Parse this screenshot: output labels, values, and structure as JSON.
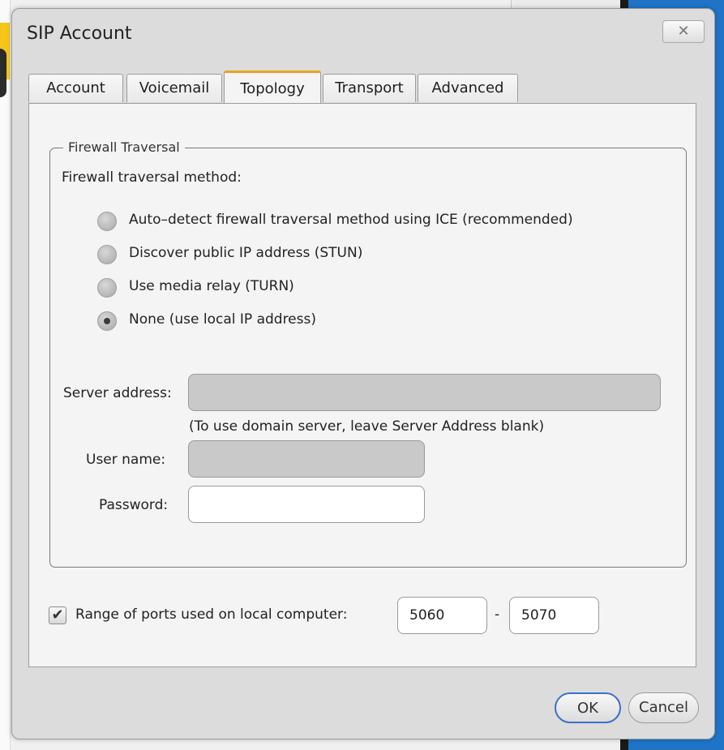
{
  "dialog": {
    "title": "SIP Account",
    "close_icon": "close-icon"
  },
  "tabs": [
    {
      "label": "Account"
    },
    {
      "label": "Voicemail"
    },
    {
      "label": "Topology"
    },
    {
      "label": "Transport"
    },
    {
      "label": "Advanced"
    }
  ],
  "active_tab": "Topology",
  "firewall": {
    "group_label": "Firewall Traversal",
    "method_label": "Firewall traversal method:",
    "options": [
      {
        "label": "Auto–detect firewall traversal method using ICE (recommended)",
        "checked": false
      },
      {
        "label": "Discover public IP address (STUN)",
        "checked": false
      },
      {
        "label": "Use media relay (TURN)",
        "checked": false
      },
      {
        "label": "None (use local IP address)",
        "checked": true
      }
    ],
    "server_address_label": "Server address:",
    "server_address_value": "",
    "server_hint": "(To use domain server, leave Server Address blank)",
    "user_name_label": "User name:",
    "user_name_value": "",
    "password_label": "Password:",
    "password_value": ""
  },
  "ports": {
    "checkbox_checked": true,
    "label": "Range of ports used on local computer:",
    "from": "5060",
    "separator": "-",
    "to": "5070"
  },
  "buttons": {
    "ok": "OK",
    "cancel": "Cancel"
  },
  "colors": {
    "active_tab_accent": "#f0a020",
    "ok_focus_border": "#3d6fc9"
  }
}
